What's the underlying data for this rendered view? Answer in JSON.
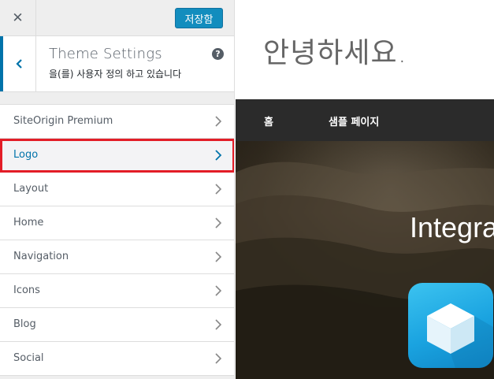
{
  "topbar": {
    "close_glyph": "✕",
    "save_label": "저장함"
  },
  "section": {
    "title": "Theme Settings",
    "subtitle": "을(를) 사용자 정의 하고 있습니다",
    "help_glyph": "?"
  },
  "menu": {
    "items": [
      {
        "label": "SiteOrigin Premium"
      },
      {
        "label": "Logo"
      },
      {
        "label": "Layout"
      },
      {
        "label": "Home"
      },
      {
        "label": "Navigation"
      },
      {
        "label": "Icons"
      },
      {
        "label": "Blog"
      },
      {
        "label": "Social"
      }
    ],
    "active_index": 1
  },
  "preview": {
    "site_title": "안녕하세요.",
    "nav": [
      {
        "label": "홈"
      },
      {
        "label": "샘플 페이지"
      }
    ],
    "hero_text": "Integra"
  },
  "colors": {
    "accent": "#0073aa",
    "save_button": "#0085ba",
    "highlight_box": "#e31d27",
    "navbar": "#2b2b2b"
  },
  "icons": {
    "close": "close-icon",
    "back": "chevron-left-icon",
    "help": "help-icon",
    "menu_chevron": "chevron-right-icon",
    "app": "cube-icon"
  }
}
